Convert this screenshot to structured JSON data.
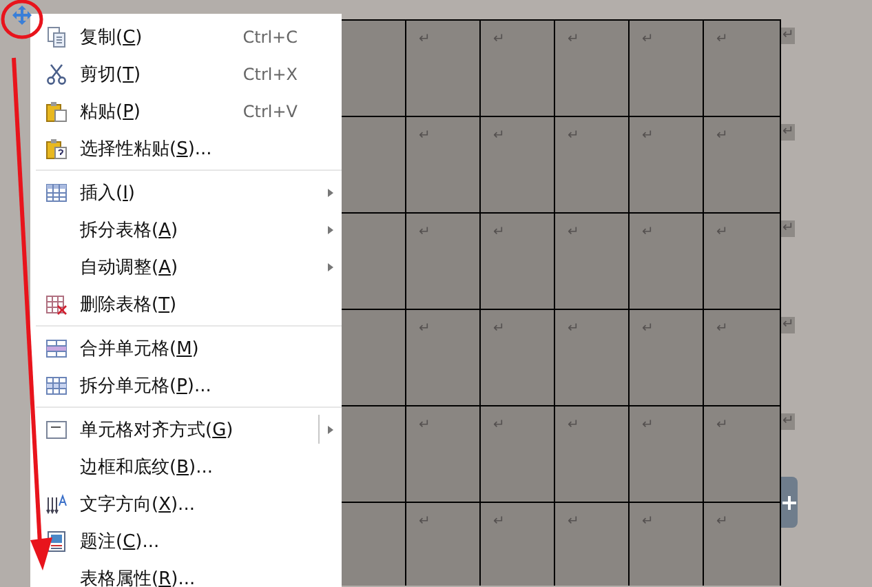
{
  "menu": {
    "items": [
      {
        "kind": "copy",
        "label": "复制(C)",
        "shortcut": "Ctrl+C",
        "submenu": false,
        "split_button": false
      },
      {
        "kind": "cut",
        "label": "剪切(T)",
        "shortcut": "Ctrl+X",
        "submenu": false,
        "split_button": false
      },
      {
        "kind": "paste",
        "label": "粘贴(P)",
        "shortcut": "Ctrl+V",
        "submenu": false,
        "split_button": false
      },
      {
        "kind": "pastespecial",
        "label": "选择性粘贴(S)...",
        "submenu": false,
        "split_button": false
      },
      {
        "kind": "separator"
      },
      {
        "kind": "table",
        "label": "插入(I)",
        "submenu": true,
        "split_button": false
      },
      {
        "kind": "plain",
        "label": "拆分表格(A)",
        "submenu": true,
        "split_button": false
      },
      {
        "kind": "plain",
        "label": "自动调整(A)",
        "submenu": true,
        "split_button": false
      },
      {
        "kind": "deletetable",
        "label": "删除表格(T)",
        "submenu": false,
        "split_button": false
      },
      {
        "kind": "separator"
      },
      {
        "kind": "merge",
        "label": "合并单元格(M)",
        "submenu": false,
        "split_button": false
      },
      {
        "kind": "split",
        "label": "拆分单元格(P)...",
        "submenu": false,
        "split_button": false
      },
      {
        "kind": "separator"
      },
      {
        "kind": "align",
        "label": "单元格对齐方式(G)",
        "submenu": true,
        "split_button": true
      },
      {
        "kind": "plain",
        "label": "边框和底纹(B)...",
        "submenu": false,
        "split_button": false
      },
      {
        "kind": "textdir",
        "label": "文字方向(X)...",
        "submenu": false,
        "split_button": false
      },
      {
        "kind": "caption",
        "label": "题注(C)...",
        "submenu": false,
        "split_button": false
      },
      {
        "kind": "plain",
        "label": "表格属性(R)...",
        "submenu": false,
        "split_button": false
      }
    ]
  },
  "table": {
    "rows": [
      {
        "cells": [
          "↵",
          "↵",
          "↵",
          "↵",
          "↵"
        ],
        "end_mark": "↵"
      },
      {
        "cells": [
          "↵",
          "↵",
          "↵",
          "↵",
          "↵"
        ],
        "end_mark": "↵"
      },
      {
        "cells": [
          "↵",
          "↵",
          "↵",
          "↵",
          "↵"
        ],
        "end_mark": "↵"
      },
      {
        "cells": [
          "↵",
          "↵",
          "↵",
          "↵",
          "↵"
        ],
        "end_mark": "↵"
      },
      {
        "cells": [
          "↵",
          "↵",
          "↵",
          "↵",
          "↵"
        ],
        "end_mark": "↵"
      },
      {
        "cells": [
          "↵",
          "↵",
          "↵",
          "↵",
          "↵"
        ]
      }
    ]
  }
}
